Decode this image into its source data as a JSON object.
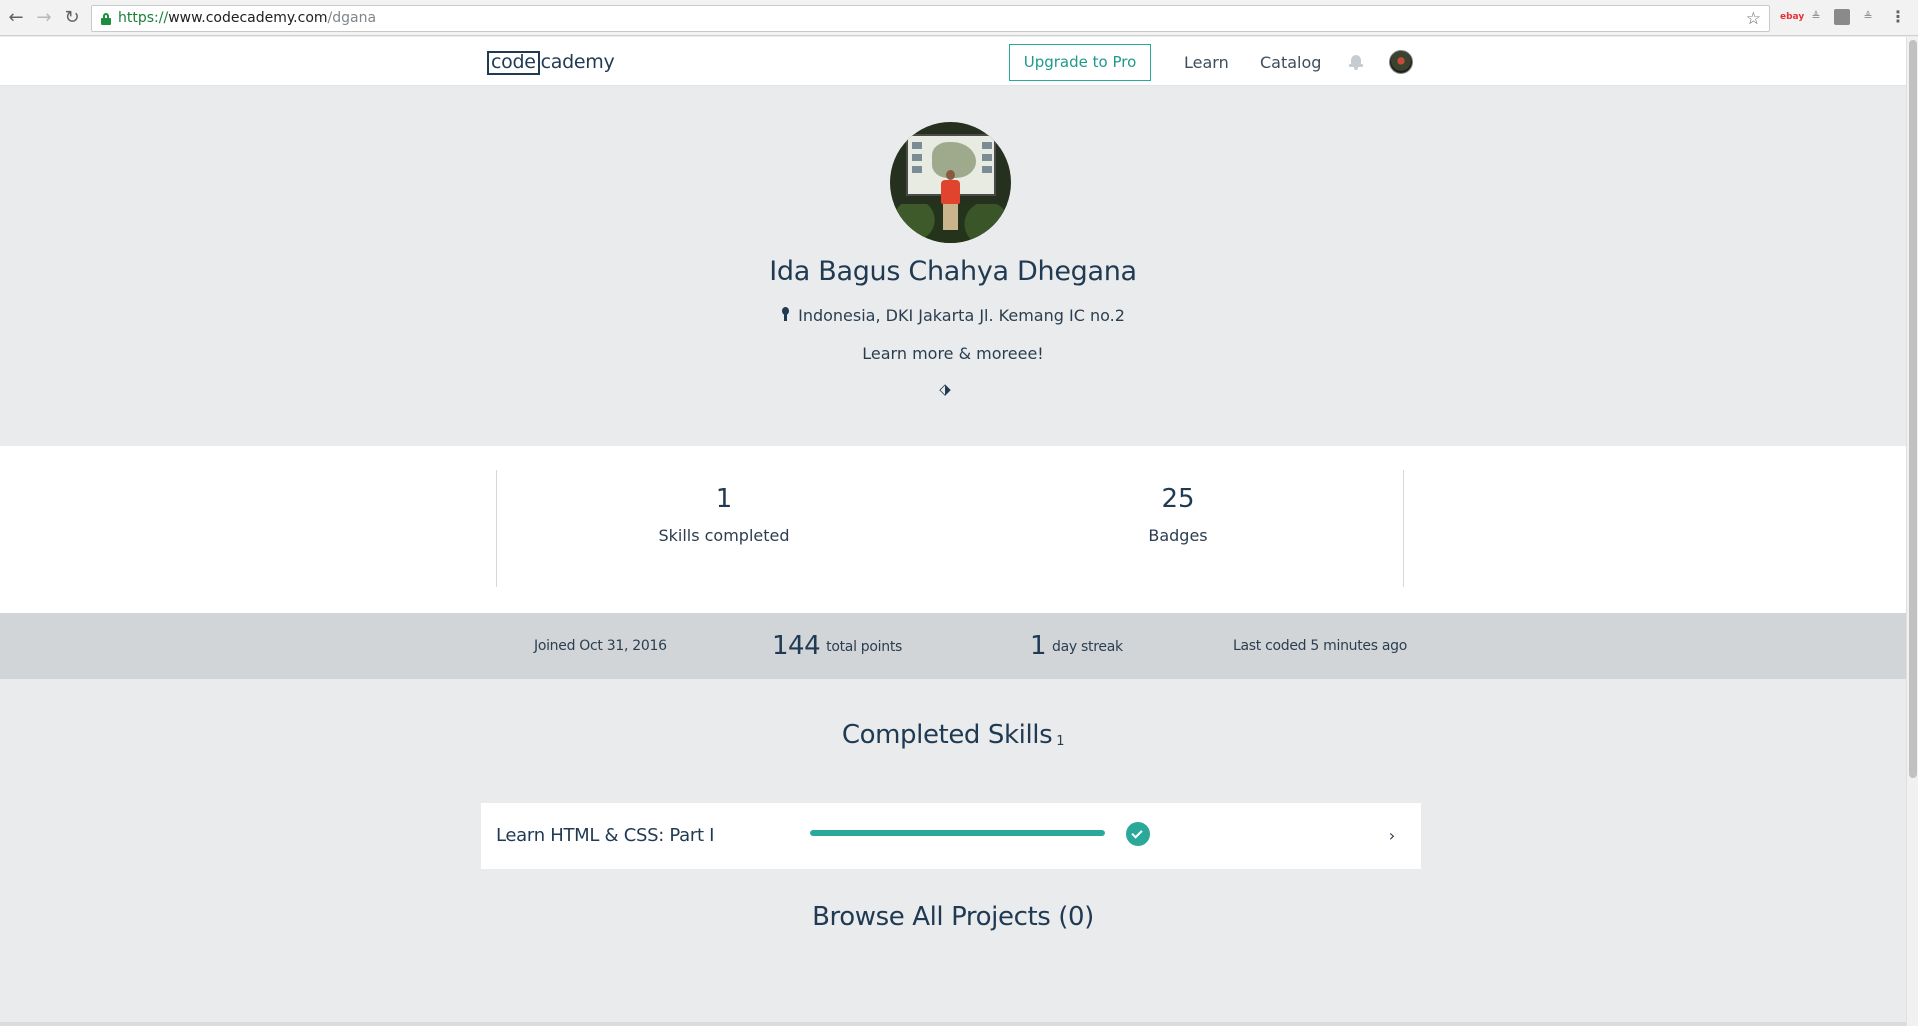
{
  "browser": {
    "url_scheme": "https://",
    "url_host": "www.codecademy.com",
    "url_path": "/dgana",
    "back_glyph": "←",
    "forward_glyph": "→",
    "reload_glyph": "↻",
    "star_glyph": "☆",
    "menu_glyph": "⋮",
    "extensions": [
      "ebay",
      "≜",
      "",
      "≜"
    ]
  },
  "header": {
    "logo_code": "code",
    "logo_rest": "cademy",
    "upgrade_label": "Upgrade to Pro",
    "nav": {
      "learn": "Learn",
      "catalog": "Catalog"
    },
    "icons": [
      "bell-icon",
      "avatar"
    ]
  },
  "profile": {
    "name": "Ida Bagus Chahya Dhegana",
    "location": "Indonesia, DKI Jakarta Jl. Kemang IC no.2",
    "bio": "Learn more & moreee!",
    "link_glyph": "⬗"
  },
  "stats": {
    "skills_value": "1",
    "skills_label": "Skills completed",
    "badges_value": "25",
    "badges_label": "Badges"
  },
  "strip": {
    "joined": "Joined Oct 31, 2016",
    "points_value": "144",
    "points_label": "total points",
    "streak_value": "1",
    "streak_label": "day streak",
    "last_coded": "Last coded 5 minutes ago"
  },
  "completed_skills": {
    "title": "Completed Skills",
    "count": "1",
    "items": [
      {
        "name": "Learn HTML & CSS: Part I",
        "progress": 1.0,
        "completed": true,
        "chevron": "›"
      }
    ]
  },
  "projects": {
    "title": "Browse All Projects (0)"
  },
  "colors": {
    "accent": "#2aa89a",
    "text": "#1f3a52",
    "hero_bg": "#e9ebec",
    "strip_bg": "#d2d5d7"
  }
}
